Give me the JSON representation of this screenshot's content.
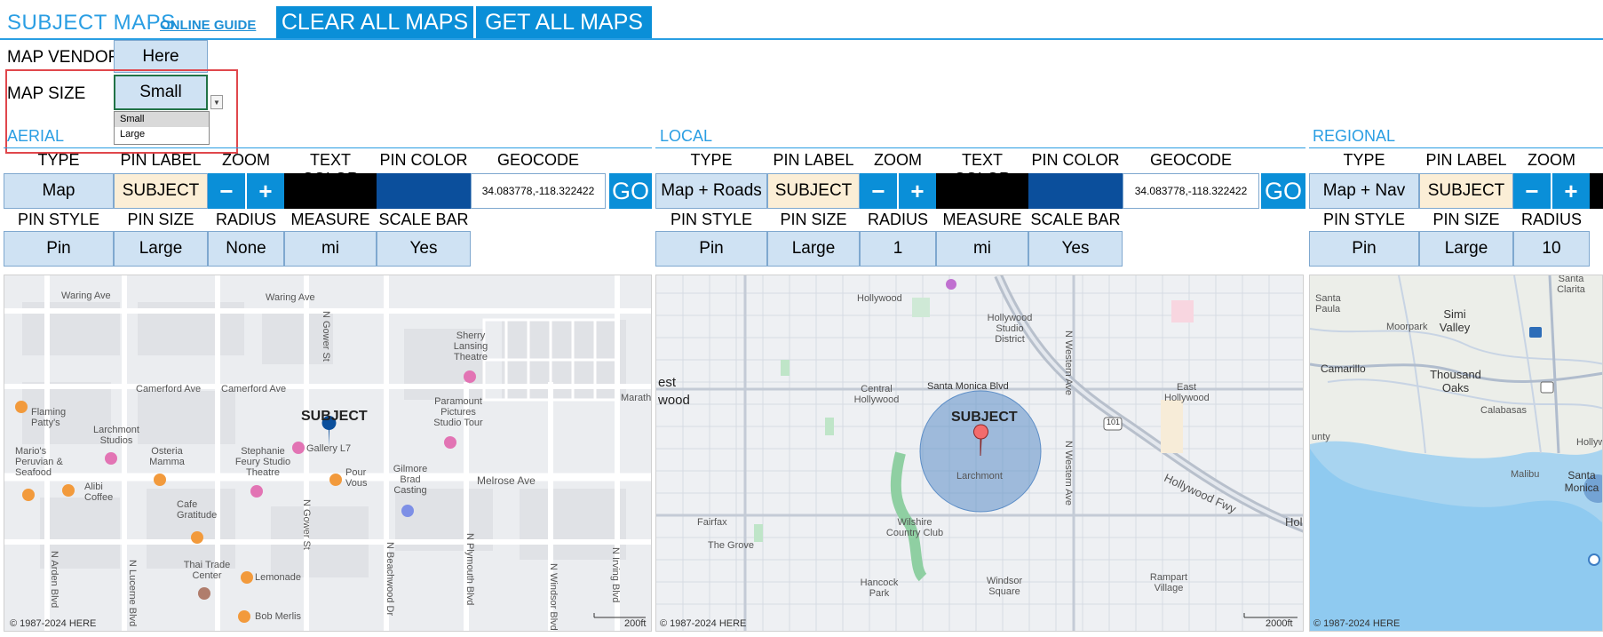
{
  "header": {
    "title": "SUBJECT MAPS",
    "guide_link": "ONLINE GUIDE",
    "clear_button": "CLEAR ALL MAPS",
    "get_button": "GET ALL MAPS"
  },
  "settings": {
    "vendor_label": "MAP VENDOR",
    "vendor_value": "Here",
    "size_label": "MAP SIZE",
    "size_value": "Small",
    "size_options": [
      "Small",
      "Large"
    ]
  },
  "column_headers": {
    "type": "TYPE",
    "pin_label": "PIN LABEL",
    "zoom": "ZOOM",
    "text_color": "TEXT COLOR",
    "pin_color": "PIN COLOR",
    "geocode": "GEOCODE",
    "pin_style": "PIN STYLE",
    "pin_size": "PIN SIZE",
    "radius": "RADIUS",
    "measure": "MEASURE",
    "scale_bar": "SCALE BAR"
  },
  "zoom_controls": {
    "minus": "−",
    "plus": "+",
    "go": "GO"
  },
  "colors": {
    "accent": "#2a9ee3",
    "button": "#0a8fd8",
    "cell": "#cfe2f3",
    "pin_label_bg": "#fbeed6",
    "text_color": "#000000",
    "pin_color": "#0b4f9c",
    "highlight_box": "#e0474c"
  },
  "sections": {
    "aerial": {
      "name": "AERIAL",
      "type": "Map",
      "pin_label": "SUBJECT",
      "geocode": "34.083778,-118.322422",
      "pin_style": "Pin",
      "pin_size": "Large",
      "radius": "None",
      "measure": "mi",
      "scale_bar": "Yes",
      "map": {
        "subject": "SUBJECT",
        "credit": "© 1987-2024 HERE",
        "scale": "200ft",
        "labels": [
          "Waring Ave",
          "Waring Ave",
          "Camerford Ave",
          "Camerford Ave",
          "Melrose Ave",
          "N Gower St",
          "N Gower St",
          "N Arden Blvd",
          "N Lucerne Blvd",
          "N Beachwood Dr",
          "N Plymouth Blvd",
          "N Windsor Blvd",
          "N Irving Blvd",
          "Sherry Lansing Theatre",
          "Paramount Pictures Studio Tour",
          "Flaming Patty's",
          "Larchmont Studios",
          "Osteria Mamma",
          "Stephanie Feury Studio Theatre",
          "Gallery L7",
          "Pour Vous",
          "Gilmore Brad Casting",
          "Mario's Peruvian & Seafood",
          "Alibi Coffee",
          "Cafe Gratitude",
          "Thai Trade Center",
          "Lemonade",
          "Bob Merlis",
          "Marath"
        ]
      }
    },
    "local": {
      "name": "LOCAL",
      "type": "Map + Roads",
      "pin_label": "SUBJECT",
      "geocode": "34.083778,-118.322422",
      "pin_style": "Pin",
      "pin_size": "Large",
      "radius": "1",
      "measure": "mi",
      "scale_bar": "Yes",
      "map": {
        "subject": "SUBJECT",
        "credit": "© 1987-2024 HERE",
        "scale": "2000ft",
        "labels": [
          "Hollywood",
          "Hollywood Studio District",
          "Santa Monica Blvd",
          "Central Hollywood",
          "East Hollywood",
          "Larchmont",
          "Wilshire Country Club",
          "Fairfax",
          "The Grove",
          "Hancock Park",
          "Windsor Square",
          "Rampart Village",
          "N Western Ave",
          "N Western Ave",
          "Hollywood Fwy",
          "101",
          "est",
          "wood",
          "Holl"
        ]
      }
    },
    "regional": {
      "name": "REGIONAL",
      "type": "Map + Nav",
      "pin_label": "SUBJECT",
      "pin_style": "Pin",
      "pin_size": "Large",
      "radius": "10",
      "map": {
        "credit": "© 1987-2024 HERE",
        "labels": [
          "Santa Paula",
          "Santa Clarita",
          "Simi Valley",
          "Moorpark",
          "Camarillo",
          "Thousand Oaks",
          "Calabasas",
          "Malibu",
          "Santa Monica",
          "Hollywo",
          "unty"
        ]
      }
    }
  }
}
